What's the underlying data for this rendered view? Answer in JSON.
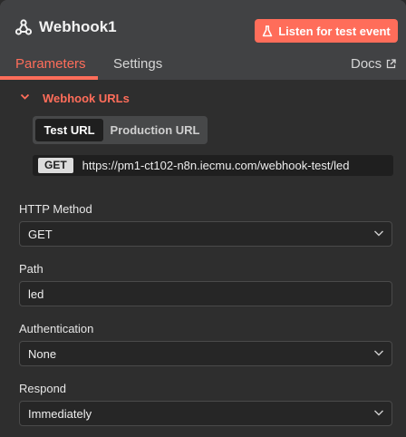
{
  "header": {
    "title": "Webhook1",
    "listen_button": "Listen for test event",
    "tabs": [
      {
        "label": "Parameters",
        "active": true
      },
      {
        "label": "Settings",
        "active": false
      }
    ],
    "docs_label": "Docs"
  },
  "webhook_urls": {
    "toggle_label": "Webhook URLs",
    "segments": [
      {
        "label": "Test URL",
        "selected": true
      },
      {
        "label": "Production URL",
        "selected": false
      }
    ],
    "method_badge": "GET",
    "url": "https://pm1-ct102-n8n.iecmu.com/webhook-test/led"
  },
  "fields": {
    "http_method": {
      "label": "HTTP Method",
      "value": "GET"
    },
    "path": {
      "label": "Path",
      "value": "led"
    },
    "authentication": {
      "label": "Authentication",
      "value": "None"
    },
    "respond": {
      "label": "Respond",
      "value": "Immediately"
    }
  },
  "colors": {
    "accent": "#ff6d5a",
    "panel_bg": "#414244",
    "body_bg": "#2e2e2e",
    "input_bg": "#262626"
  },
  "icons": {
    "node": "webhook-icon",
    "listen": "beaker-icon",
    "docs": "external-link-icon",
    "collapse": "chevron-down-icon",
    "dropdown": "chevron-down-icon"
  }
}
